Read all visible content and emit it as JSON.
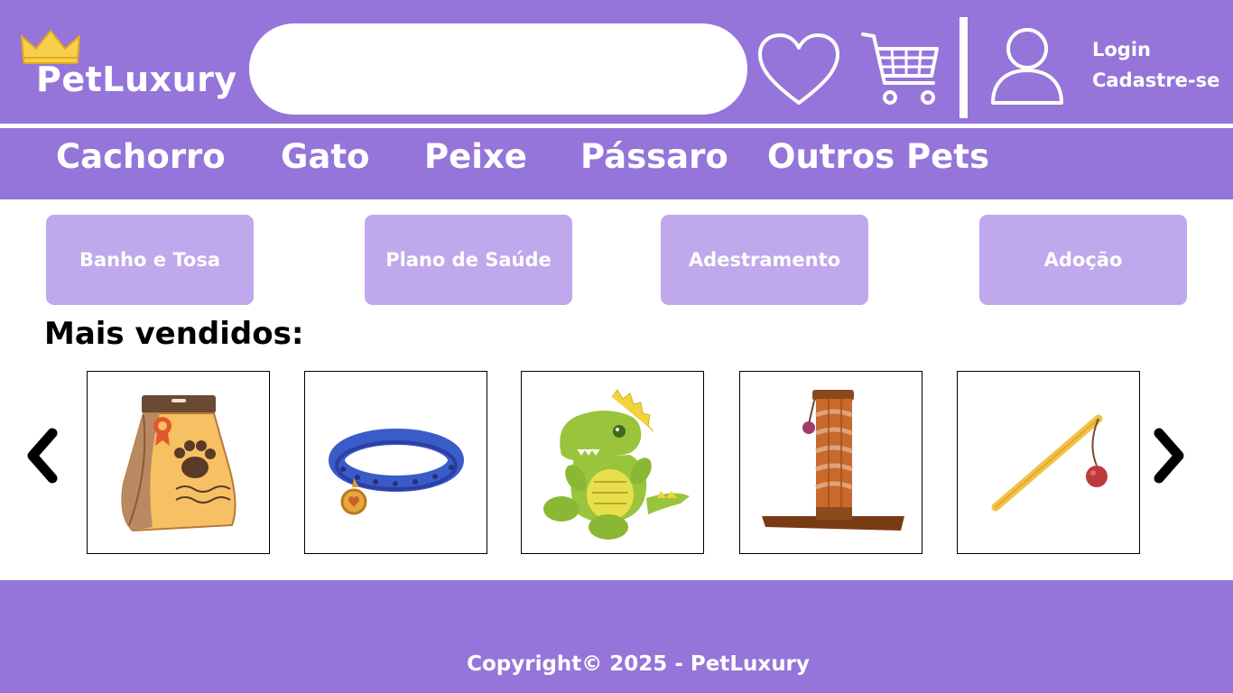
{
  "brand": {
    "name": "PetLuxury",
    "icon": "crown-icon"
  },
  "search": {
    "placeholder": "",
    "value": ""
  },
  "header": {
    "wishlist_icon": "heart-icon",
    "cart_icon": "shopping-cart-icon",
    "account_icon": "user-icon",
    "login": "Login",
    "signup": "Cadastre-se"
  },
  "nav": {
    "items": [
      {
        "label": "Cachorro"
      },
      {
        "label": "Gato"
      },
      {
        "label": "Peixe"
      },
      {
        "label": "Pássaro"
      },
      {
        "label": "Outros Pets"
      }
    ]
  },
  "services": [
    {
      "label": "Banho e Tosa"
    },
    {
      "label": "Plano de Saúde"
    },
    {
      "label": "Adestramento"
    },
    {
      "label": "Adoção"
    }
  ],
  "bestsellers": {
    "title": "Mais vendidos:",
    "prev_icon": "chevron-left-icon",
    "next_icon": "chevron-right-icon",
    "products": [
      {
        "image": "pet-food-bag-icon"
      },
      {
        "image": "pet-collar-icon"
      },
      {
        "image": "dinosaur-plush-toy-icon"
      },
      {
        "image": "cat-scratching-post-icon"
      },
      {
        "image": "cat-wand-toy-icon"
      }
    ]
  },
  "footer": {
    "copyright": "Copyright© 2025 - PetLuxury"
  },
  "colors": {
    "primary": "#9575d9",
    "service_button": "#bfa8eb",
    "text_light": "#ffffff"
  }
}
